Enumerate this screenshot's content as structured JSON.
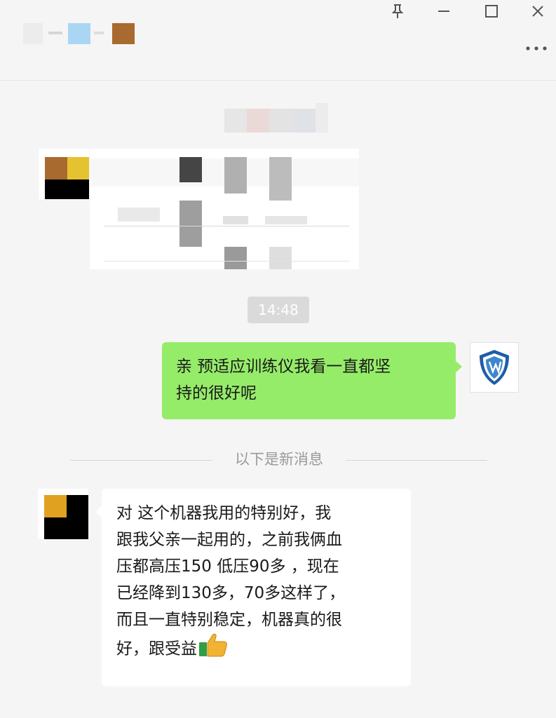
{
  "window": {
    "pin_icon": "pin-icon",
    "minimize_icon": "minimize-icon",
    "maximize_icon": "maximize-icon",
    "close_icon": "close-icon",
    "more_icon": "more-icon"
  },
  "chat": {
    "timestamp": "14:48",
    "outgoing_message": {
      "lines": [
        "亲 预适应训练仪我看一直都坚",
        "持的很好呢"
      ]
    },
    "new_messages_divider": "以下是新消息",
    "incoming_message": {
      "lines": [
        "对 这个机器我用的特别好，我",
        "跟我父亲一起用的，之前我俩血",
        "压都高压150 低压90多 ，现在",
        "已经降到130多，70多这样了，",
        "而且一直特别稳定，机器真的很",
        "好，跟受益"
      ],
      "emoji": "thumbs-up-emoji"
    }
  },
  "colors": {
    "outgoing_bubble": "#95ec69",
    "incoming_bubble": "#ffffff",
    "background": "#f5f5f5",
    "timestamp_bg": "#dadada"
  }
}
